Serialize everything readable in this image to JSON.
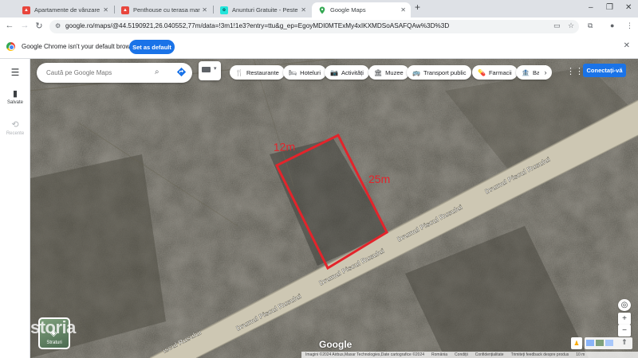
{
  "browser": {
    "tabs": [
      {
        "title": "Apartamente de vânzare în Buc",
        "favicon": "storia-icon",
        "color": "#e8453c",
        "active": false
      },
      {
        "title": "Penthouse cu terasa mare in zo",
        "favicon": "storia-icon",
        "color": "#e8453c",
        "active": false
      },
      {
        "title": "Anunturi Gratuite - Peste 4 mil",
        "favicon": "olx-icon",
        "color": "#23e5db",
        "active": false
      },
      {
        "title": "Google Maps",
        "favicon": "maps-pin-icon",
        "color": "#34a853",
        "active": true
      }
    ],
    "new_tab": "+",
    "window_controls": [
      "‒",
      "❐",
      "✕"
    ],
    "url": "google.ro/maps/@44.5190921,26.040552,77m/data=!3m1!1e3?entry=ttu&g_ep=EgoyMDI0MTExMy4xIKXMDSoASAFQAw%3D%3D"
  },
  "infobar": {
    "message": "Google Chrome isn't your default browser",
    "button": "Set as default",
    "close": "✕"
  },
  "rail": {
    "menu": "☰",
    "items": [
      {
        "label": "Salvate",
        "icon": "bookmark-icon",
        "glyph": "🔖"
      },
      {
        "label": "Recente",
        "icon": "history-icon",
        "glyph": "⟲"
      }
    ]
  },
  "search": {
    "placeholder": "Caută pe Google Maps"
  },
  "chips": [
    {
      "label": "Restaurante",
      "icon": "restaurant-icon",
      "glyph": "🍴"
    },
    {
      "label": "Hoteluri",
      "icon": "hotel-icon",
      "glyph": "🛏"
    },
    {
      "label": "Activități",
      "icon": "camera-icon",
      "glyph": "📷"
    },
    {
      "label": "Muzee",
      "icon": "museum-icon",
      "glyph": "🏛"
    },
    {
      "label": "Transport public",
      "icon": "bus-icon",
      "glyph": "🚌"
    },
    {
      "label": "Farmacii",
      "icon": "pharmacy-icon",
      "glyph": "💊"
    },
    {
      "label": "Banc",
      "icon": "bank-icon",
      "glyph": "🏦"
    }
  ],
  "signin": "Conectați-vă",
  "map": {
    "road_labels": [
      "Drumul Piscul Rusului",
      "Drumul Piscul Rusului",
      "Drumul Piscul Rusului",
      "Drumul Piscul Rusului",
      "iscul Rusului"
    ],
    "annotations": {
      "width": "12m",
      "length": "25m"
    },
    "annotation_color": "#e3242b",
    "road_color": "#cdc7b3"
  },
  "layers_label": "Straturi",
  "watermark": "storia",
  "google_logo": "Google",
  "footer": [
    "Imagini ©2024 Airbus,Maxar Technologies,Date cartografice ©2024",
    "România",
    "Condiții",
    "Confidențialitate",
    "Trimiteți feedback despre produs",
    "10 m"
  ]
}
